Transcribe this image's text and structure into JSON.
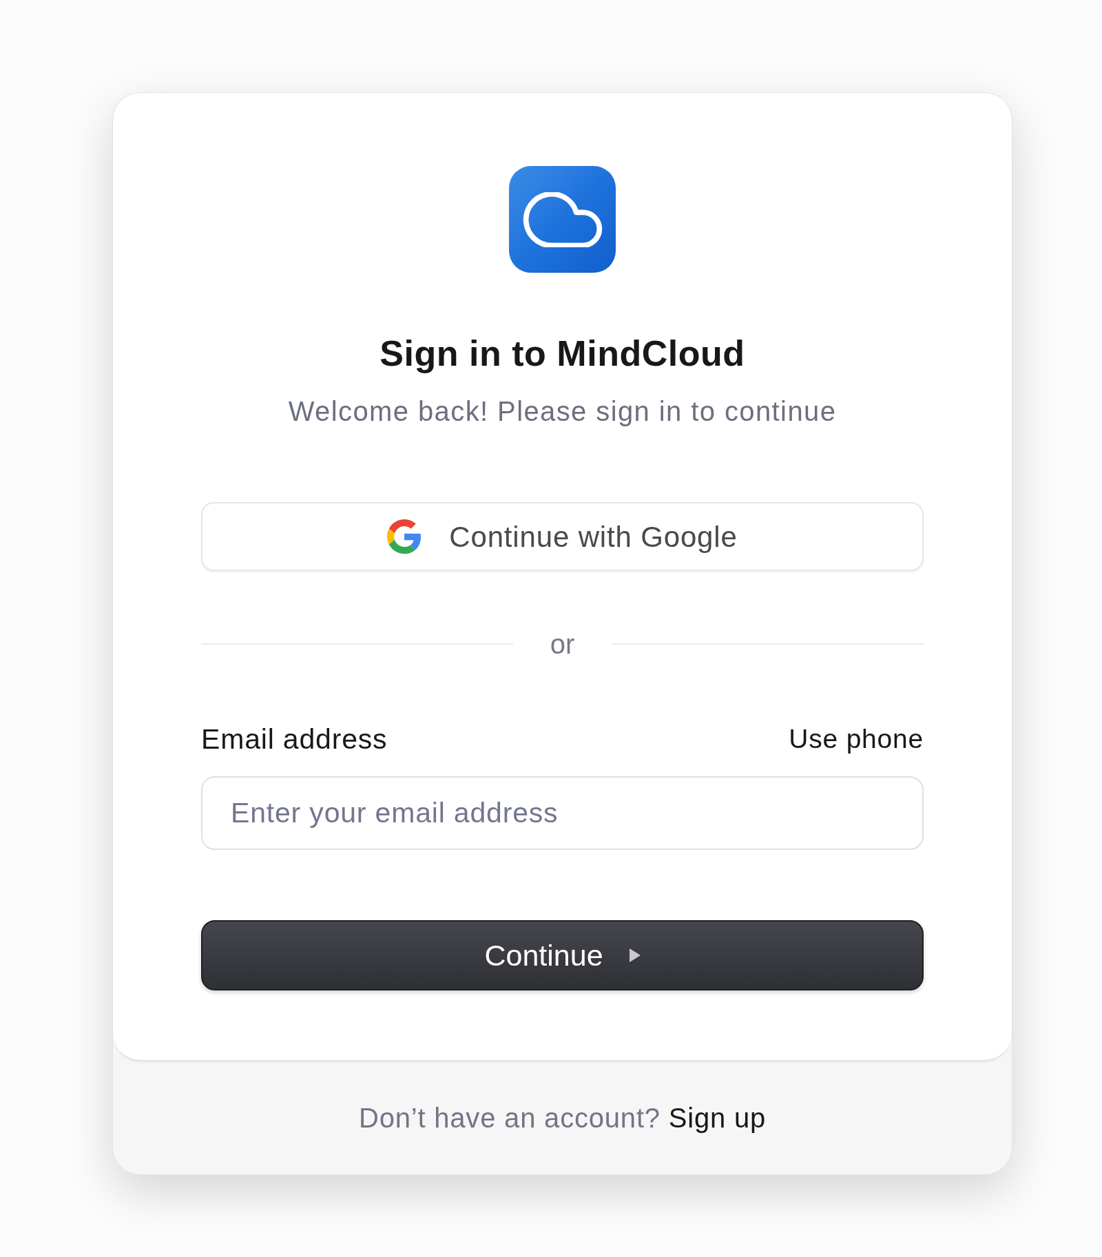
{
  "heading": {
    "title": "Sign in to MindCloud",
    "subtitle": "Welcome back! Please sign in to continue"
  },
  "social_button": {
    "label": "Continue with Google"
  },
  "divider": {
    "label": "or"
  },
  "email": {
    "label": "Email address",
    "alternate_link": "Use phone",
    "placeholder": "Enter your email address"
  },
  "submit_button": {
    "label": "Continue"
  },
  "footer": {
    "prompt": "Don’t have an account?",
    "link": "Sign up"
  }
}
